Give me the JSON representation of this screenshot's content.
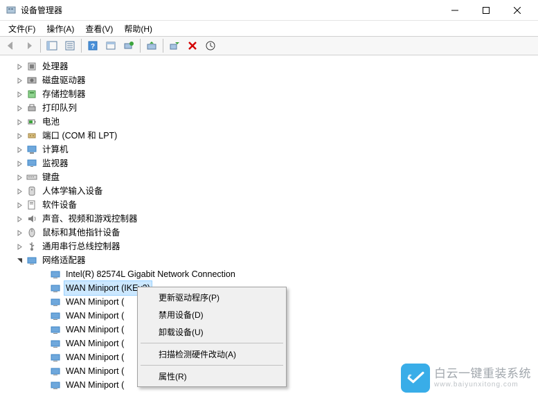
{
  "window": {
    "title": "设备管理器"
  },
  "menu": {
    "file": "文件(F)",
    "action": "操作(A)",
    "view": "查看(V)",
    "help": "帮助(H)"
  },
  "tree": {
    "items": [
      {
        "label": "处理器",
        "icon": "cpu",
        "expanded": false
      },
      {
        "label": "磁盘驱动器",
        "icon": "disk",
        "expanded": false
      },
      {
        "label": "存储控制器",
        "icon": "storage",
        "expanded": false
      },
      {
        "label": "打印队列",
        "icon": "printer",
        "expanded": false
      },
      {
        "label": "电池",
        "icon": "battery",
        "expanded": false
      },
      {
        "label": "端口 (COM 和 LPT)",
        "icon": "port",
        "expanded": false
      },
      {
        "label": "计算机",
        "icon": "computer",
        "expanded": false
      },
      {
        "label": "监视器",
        "icon": "monitor",
        "expanded": false
      },
      {
        "label": "键盘",
        "icon": "keyboard",
        "expanded": false
      },
      {
        "label": "人体学输入设备",
        "icon": "hid",
        "expanded": false
      },
      {
        "label": "软件设备",
        "icon": "software",
        "expanded": false
      },
      {
        "label": "声音、视频和游戏控制器",
        "icon": "sound",
        "expanded": false
      },
      {
        "label": "鼠标和其他指针设备",
        "icon": "mouse",
        "expanded": false
      },
      {
        "label": "通用串行总线控制器",
        "icon": "usb",
        "expanded": false
      },
      {
        "label": "网络适配器",
        "icon": "network",
        "expanded": true
      }
    ],
    "network_children": [
      {
        "label": "Intel(R) 82574L Gigabit Network Connection",
        "selected": false
      },
      {
        "label": "WAN Miniport (IKEv2)",
        "selected": true
      },
      {
        "label": "WAN Miniport (",
        "selected": false
      },
      {
        "label": "WAN Miniport (",
        "selected": false
      },
      {
        "label": "WAN Miniport (",
        "selected": false
      },
      {
        "label": "WAN Miniport (",
        "selected": false
      },
      {
        "label": "WAN Miniport (",
        "selected": false
      },
      {
        "label": "WAN Miniport (",
        "selected": false
      },
      {
        "label": "WAN Miniport (",
        "selected": false
      }
    ]
  },
  "context_menu": {
    "update_driver": "更新驱动程序(P)",
    "disable_device": "禁用设备(D)",
    "uninstall_device": "卸载设备(U)",
    "scan_hardware": "扫描检测硬件改动(A)",
    "properties": "属性(R)"
  },
  "watermark": {
    "line1": "白云一键重装系统",
    "line2": "www.baiyunxitong.com"
  }
}
